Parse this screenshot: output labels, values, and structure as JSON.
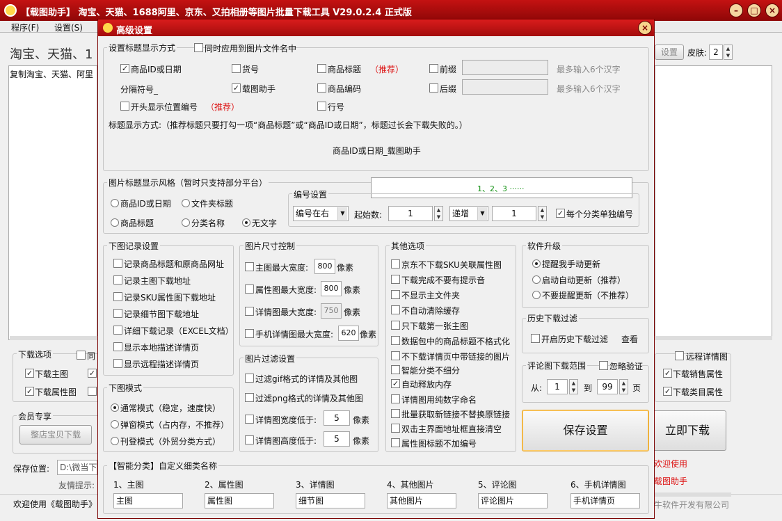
{
  "window": {
    "title": "【载图助手】 淘宝、天猫、1688阿里、京东、又拍相册等图片批量下载工具 V29.0.2.4 正式版"
  },
  "menu": {
    "program": "程序(F)",
    "settings": "设置(S)"
  },
  "main": {
    "heading": "淘宝、天猫、1",
    "hint": "复制淘宝、天猫、阿里",
    "settings_btn": "设置",
    "skin_label": "皮肤:",
    "skin_value": "2",
    "dl_group": "下载选项",
    "dl_main": "下载主图",
    "dl_attr": "下载属性图",
    "dl_same": "同",
    "remote_detail": "远程详情图",
    "dl_sales": "下载销售属性",
    "dl_cat": "下载类目属性",
    "member_group": "会员专享",
    "shop_btn": "整店宝贝下载",
    "save_loc": "保存位置:",
    "save_path": "D:\\微当下",
    "tip": "友情提示:",
    "welcome": "欢迎使用《载图助手》",
    "download_btn": "立即下载",
    "thanks": "欢迎使用",
    "brand": "载图助手",
    "company": "牛软件开发有限公司"
  },
  "dialog": {
    "title": "高级设置",
    "title_mode": {
      "label": "设置标题显示方式",
      "apply_file": "同时应用到图片文件名中",
      "goods_id": "商品ID或日期",
      "huohao": "货号",
      "goods_title": "商品标题",
      "recommend": "（推荐）",
      "prefix": "前缀",
      "max6": "最多输入6个汉字",
      "separator": "分隔符号_",
      "zaitu": "载图助手",
      "goods_code": "商品编码",
      "suffix": "后缀",
      "max6b": "最多输入6个汉字",
      "show_pos": "开头显示位置编号",
      "recommend2": "（推荐）",
      "row_num": "行号",
      "note": "标题显示方式:（推荐标题只要打勾一项“商品标题”或“商品ID或日期”，标题过长会下载失败的。）",
      "preview": "商品ID或日期_载图助手"
    },
    "img_style": {
      "label": "图片标题显示风格（暂时只支持部分平台）",
      "r1": "商品ID或日期",
      "r2": "文件夹标题",
      "r3": "商品标题",
      "r4": "分类名称",
      "r5": "无文字",
      "number_preview": "1、2、3 ······"
    },
    "numbering": {
      "label": "编号设置",
      "pos": "编号在右",
      "start_label": "起始数:",
      "start": "1",
      "order": "递增",
      "step": "1",
      "per_cat": "每个分类单独编号"
    },
    "record": {
      "label": "下图记录设置",
      "i1": "记录商品标题和原商品网址",
      "i2": "记录主图下载地址",
      "i3": "记录SKU属性图下载地址",
      "i4": "记录细节图下载地址",
      "i5": "详细下载记录（EXCEL文档）",
      "i6": "显示本地描述详情页",
      "i7": "显示远程描述详情页"
    },
    "size": {
      "label": "图片尺寸控制",
      "main_max": "主图最大宽度:",
      "main_val": "800",
      "px": "像素",
      "attr_max": "属性图最大宽度:",
      "attr_val": "800",
      "px2": "像素",
      "detail_max": "详情图最大宽度:",
      "detail_val": "750",
      "px3": "像素",
      "mobile_max": "手机详情图最大宽度:",
      "mobile_val": "620",
      "px4": "像素"
    },
    "filter": {
      "label": "图片过滤设置",
      "gif": "过滤gif格式的详情及其他图",
      "png": "过滤png格式的详情及其他图",
      "w_low": "详情图宽度低于:",
      "w_val": "5",
      "px": "像素",
      "h_low": "详情图高度低于:",
      "h_val": "5",
      "px2": "像素"
    },
    "mode": {
      "label": "下图模式",
      "m1": "通常模式（稳定，速度快）",
      "m2": "弹窗模式（占内存，不推荐）",
      "m3": "刊登模式（外贸分类方式）"
    },
    "other": {
      "label": "其他选项",
      "o1": "京东不下载SKU关联属性图",
      "o2": "下载完成不要有提示音",
      "o3": "不显示主文件夹",
      "o4": "不自动清除缓存",
      "o5": "只下载第一张主图",
      "o6": "数据包中的商品标题不格式化",
      "o7": "不下载详情页中带链接的图片",
      "o8": "智能分类不细分",
      "o9": "自动释放内存",
      "o10": "详情图用纯数字命名",
      "o11": "批量获取新链接不替换原链接",
      "o12": "双击主界面地址框直接清空",
      "o13": "属性图标题不加编号"
    },
    "upgrade": {
      "label": "软件升级",
      "u1": "提醒我手动更新",
      "u2": "启动自动更新（推荐）",
      "u3": "不要提醒更新（不推荐）"
    },
    "history": {
      "label": "历史下载过滤",
      "enable": "开启历史下载过滤",
      "view": "查看"
    },
    "review": {
      "label": "评论图下载范围",
      "ignore": "忽略验证",
      "from": "从:",
      "from_val": "1",
      "to": "到",
      "to_val": "99",
      "page": "页"
    },
    "save_btn": "保存设置",
    "smart": {
      "label": "【智能分类】自定义细类名称",
      "l1": "1、主图",
      "l2": "2、属性图",
      "l3": "3、详情图",
      "l4": "4、其他图片",
      "l5": "5、评论图",
      "l6": "6、手机详情图",
      "v1": "主图",
      "v2": "属性图",
      "v3": "细节图",
      "v4": "其他图片",
      "v5": "评论图片",
      "v6": "手机详情页"
    }
  },
  "colors": {
    "title_bar": "#b10d0d",
    "accent_red": "#d11111",
    "dialog_bg": "#f0f0f0"
  }
}
